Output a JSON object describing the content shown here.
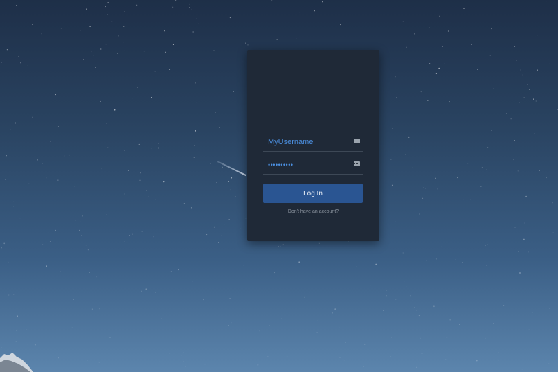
{
  "login": {
    "username_value": "MyUsername",
    "password_value": "••••••••••",
    "login_button_label": "Log In",
    "signup_link_text": "Don't have an account?"
  },
  "icons": {
    "username_field_icon": "key-icon",
    "password_field_icon": "key-icon"
  },
  "colors": {
    "card_background": "#1f2937",
    "button_background": "#2a5592",
    "input_text": "#4b8fe0",
    "link_text": "#8a939e"
  }
}
